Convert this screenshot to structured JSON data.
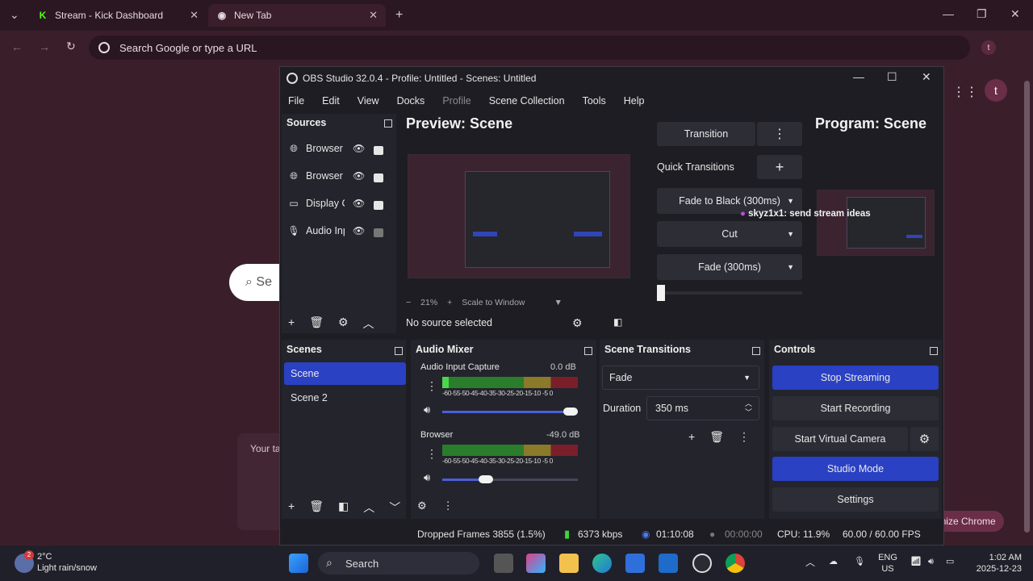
{
  "browser": {
    "tabs": [
      {
        "title": "Stream - Kick Dashboard",
        "icon": "K"
      },
      {
        "title": "New Tab"
      }
    ],
    "omnibox_placeholder": "Search Google or type a URL",
    "profile_initial": "t",
    "newtab": {
      "search_fragment": "Se",
      "card_text": "Your ta",
      "customize_label": "mize Chrome",
      "avatar_initial": "t"
    }
  },
  "obs": {
    "title": "OBS Studio 32.0.4 - Profile: Untitled - Scenes: Untitled",
    "menu": [
      "File",
      "Edit",
      "View",
      "Docks",
      "Profile",
      "Scene Collection",
      "Tools",
      "Help"
    ],
    "sources_header": "Sources",
    "sources": [
      {
        "name": "Browser",
        "icon": "globe-icon",
        "locked": true
      },
      {
        "name": "Browser",
        "icon": "globe-icon",
        "locked": true
      },
      {
        "name": "Display Capture",
        "icon": "monitor-icon",
        "locked": true
      },
      {
        "name": "Audio Input Capture",
        "icon": "microphone-icon",
        "locked": false
      }
    ],
    "preview_title": "Preview: Scene",
    "program_title": "Program: Scene",
    "zoom": "21%",
    "scale_mode": "Scale to Window",
    "no_source": "No source selected",
    "transition_button": "Transition",
    "quick_transitions_label": "Quick Transitions",
    "quick_transitions": [
      "Fade to Black (300ms)",
      "Cut",
      "Fade (300ms)"
    ],
    "chat_overlay": "skyz1x1: send stream ideas",
    "scenes_header": "Scenes",
    "scenes": [
      "Scene",
      "Scene 2"
    ],
    "audio_header": "Audio Mixer",
    "audio_tracks": [
      {
        "name": "Audio Input Capture",
        "db": "0.0 dB",
        "level": 0.05,
        "volume": 1.0
      },
      {
        "name": "Browser",
        "db": "-49.0 dB",
        "level": 0.0,
        "volume": 0.3
      }
    ],
    "meter_scale": "-60-55-50-45-40-35-30-25-20-15-10 -5  0",
    "transitions_header": "Scene Transitions",
    "transition_selected": "Fade",
    "duration_label": "Duration",
    "duration_value": "350 ms",
    "controls_header": "Controls",
    "controls": {
      "stop_streaming": "Stop Streaming",
      "start_recording": "Start Recording",
      "start_virtual_camera": "Start Virtual Camera",
      "studio_mode": "Studio Mode",
      "settings": "Settings"
    },
    "status": {
      "dropped_frames": "Dropped Frames 3855 (1.5%)",
      "bitrate": "6373 kbps",
      "stream_time": "01:10:08",
      "record_time": "00:00:00",
      "cpu": "CPU: 11.9%",
      "fps": "60.00 / 60.00 FPS"
    }
  },
  "taskbar": {
    "weather_temp": "2°C",
    "weather_desc": "Light rain/snow",
    "weather_badge": "2",
    "search_label": "Search",
    "lang_line1": "ENG",
    "lang_line2": "US",
    "time": "1:02 AM",
    "date": "2025-12-23"
  },
  "colors": {
    "accent_blue": "#2a41c4",
    "obs_bg": "#1d1d23",
    "browser_bg": "#3a1f2a"
  }
}
